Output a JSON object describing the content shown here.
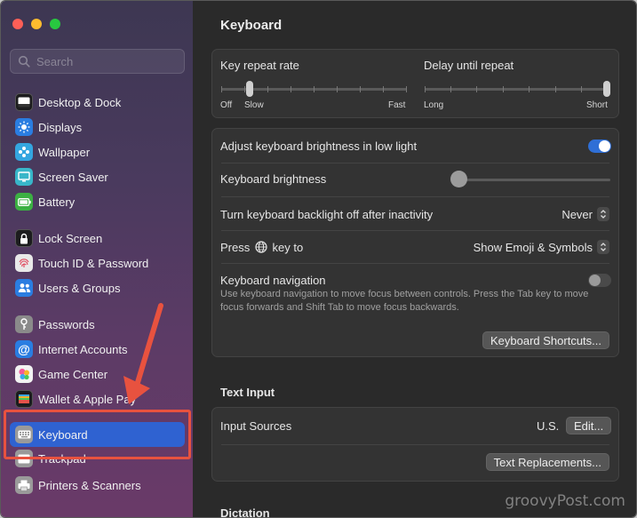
{
  "sidebar": {
    "search_placeholder": "Search",
    "items": [
      {
        "label": "Desktop & Dock",
        "icon": "desktop-dock-icon",
        "color": "#1c1c1e"
      },
      {
        "label": "Displays",
        "icon": "displays-icon",
        "color": "#2a7de1"
      },
      {
        "label": "Wallpaper",
        "icon": "wallpaper-icon",
        "color": "#34a6e0"
      },
      {
        "label": "Screen Saver",
        "icon": "screen-saver-icon",
        "color": "#38b6c9"
      },
      {
        "label": "Battery",
        "icon": "battery-icon",
        "color": "#3cb043"
      },
      {
        "label": "Lock Screen",
        "icon": "lock-screen-icon",
        "color": "#1c1c1e"
      },
      {
        "label": "Touch ID & Password",
        "icon": "fingerprint-icon",
        "color": "#e9e9e9"
      },
      {
        "label": "Users & Groups",
        "icon": "users-groups-icon",
        "color": "#2a7de1"
      },
      {
        "label": "Passwords",
        "icon": "key-icon",
        "color": "#8a8a8a"
      },
      {
        "label": "Internet Accounts",
        "icon": "at-icon",
        "color": "#2a7de1"
      },
      {
        "label": "Game Center",
        "icon": "game-center-icon",
        "color": "#f2f2f2"
      },
      {
        "label": "Wallet & Apple Pay",
        "icon": "wallet-icon",
        "color": "#1c1c1e"
      },
      {
        "label": "Keyboard",
        "icon": "keyboard-icon",
        "color": "#9a9a9a"
      },
      {
        "label": "Trackpad",
        "icon": "trackpad-icon",
        "color": "#9a9a9a"
      },
      {
        "label": "Printers & Scanners",
        "icon": "printer-icon",
        "color": "#9a9a9a"
      }
    ],
    "selected": "Keyboard"
  },
  "main": {
    "title": "Keyboard",
    "key_repeat": {
      "label": "Key repeat rate",
      "min": "Off",
      "slow": "Slow",
      "max": "Fast",
      "level": 0.09
    },
    "delay": {
      "label": "Delay until repeat",
      "min": "Long",
      "max": "Short",
      "level": 1.0
    },
    "adjust_brightness": {
      "label": "Adjust keyboard brightness in low light",
      "on": true
    },
    "brightness": {
      "label": "Keyboard brightness",
      "level": 0.0
    },
    "backlight_off": {
      "label": "Turn keyboard backlight off after inactivity",
      "value": "Never"
    },
    "press_key": {
      "label_pre": "Press",
      "label_post": "key to",
      "value": "Show Emoji & Symbols"
    },
    "navigation": {
      "label": "Keyboard navigation",
      "description": "Use keyboard navigation to move focus between controls. Press the Tab key to move focus forwards and Shift Tab to move focus backwards.",
      "on": false
    },
    "shortcuts_button": "Keyboard Shortcuts...",
    "text_input": {
      "title": "Text Input",
      "input_sources_label": "Input Sources",
      "input_sources_value": "U.S.",
      "edit_button": "Edit...",
      "replacements_button": "Text Replacements..."
    },
    "dictation_title": "Dictation"
  },
  "watermark": "groovyPost.com",
  "colors": {
    "accent": "#2f62d1",
    "annotation": "#e8523f"
  }
}
